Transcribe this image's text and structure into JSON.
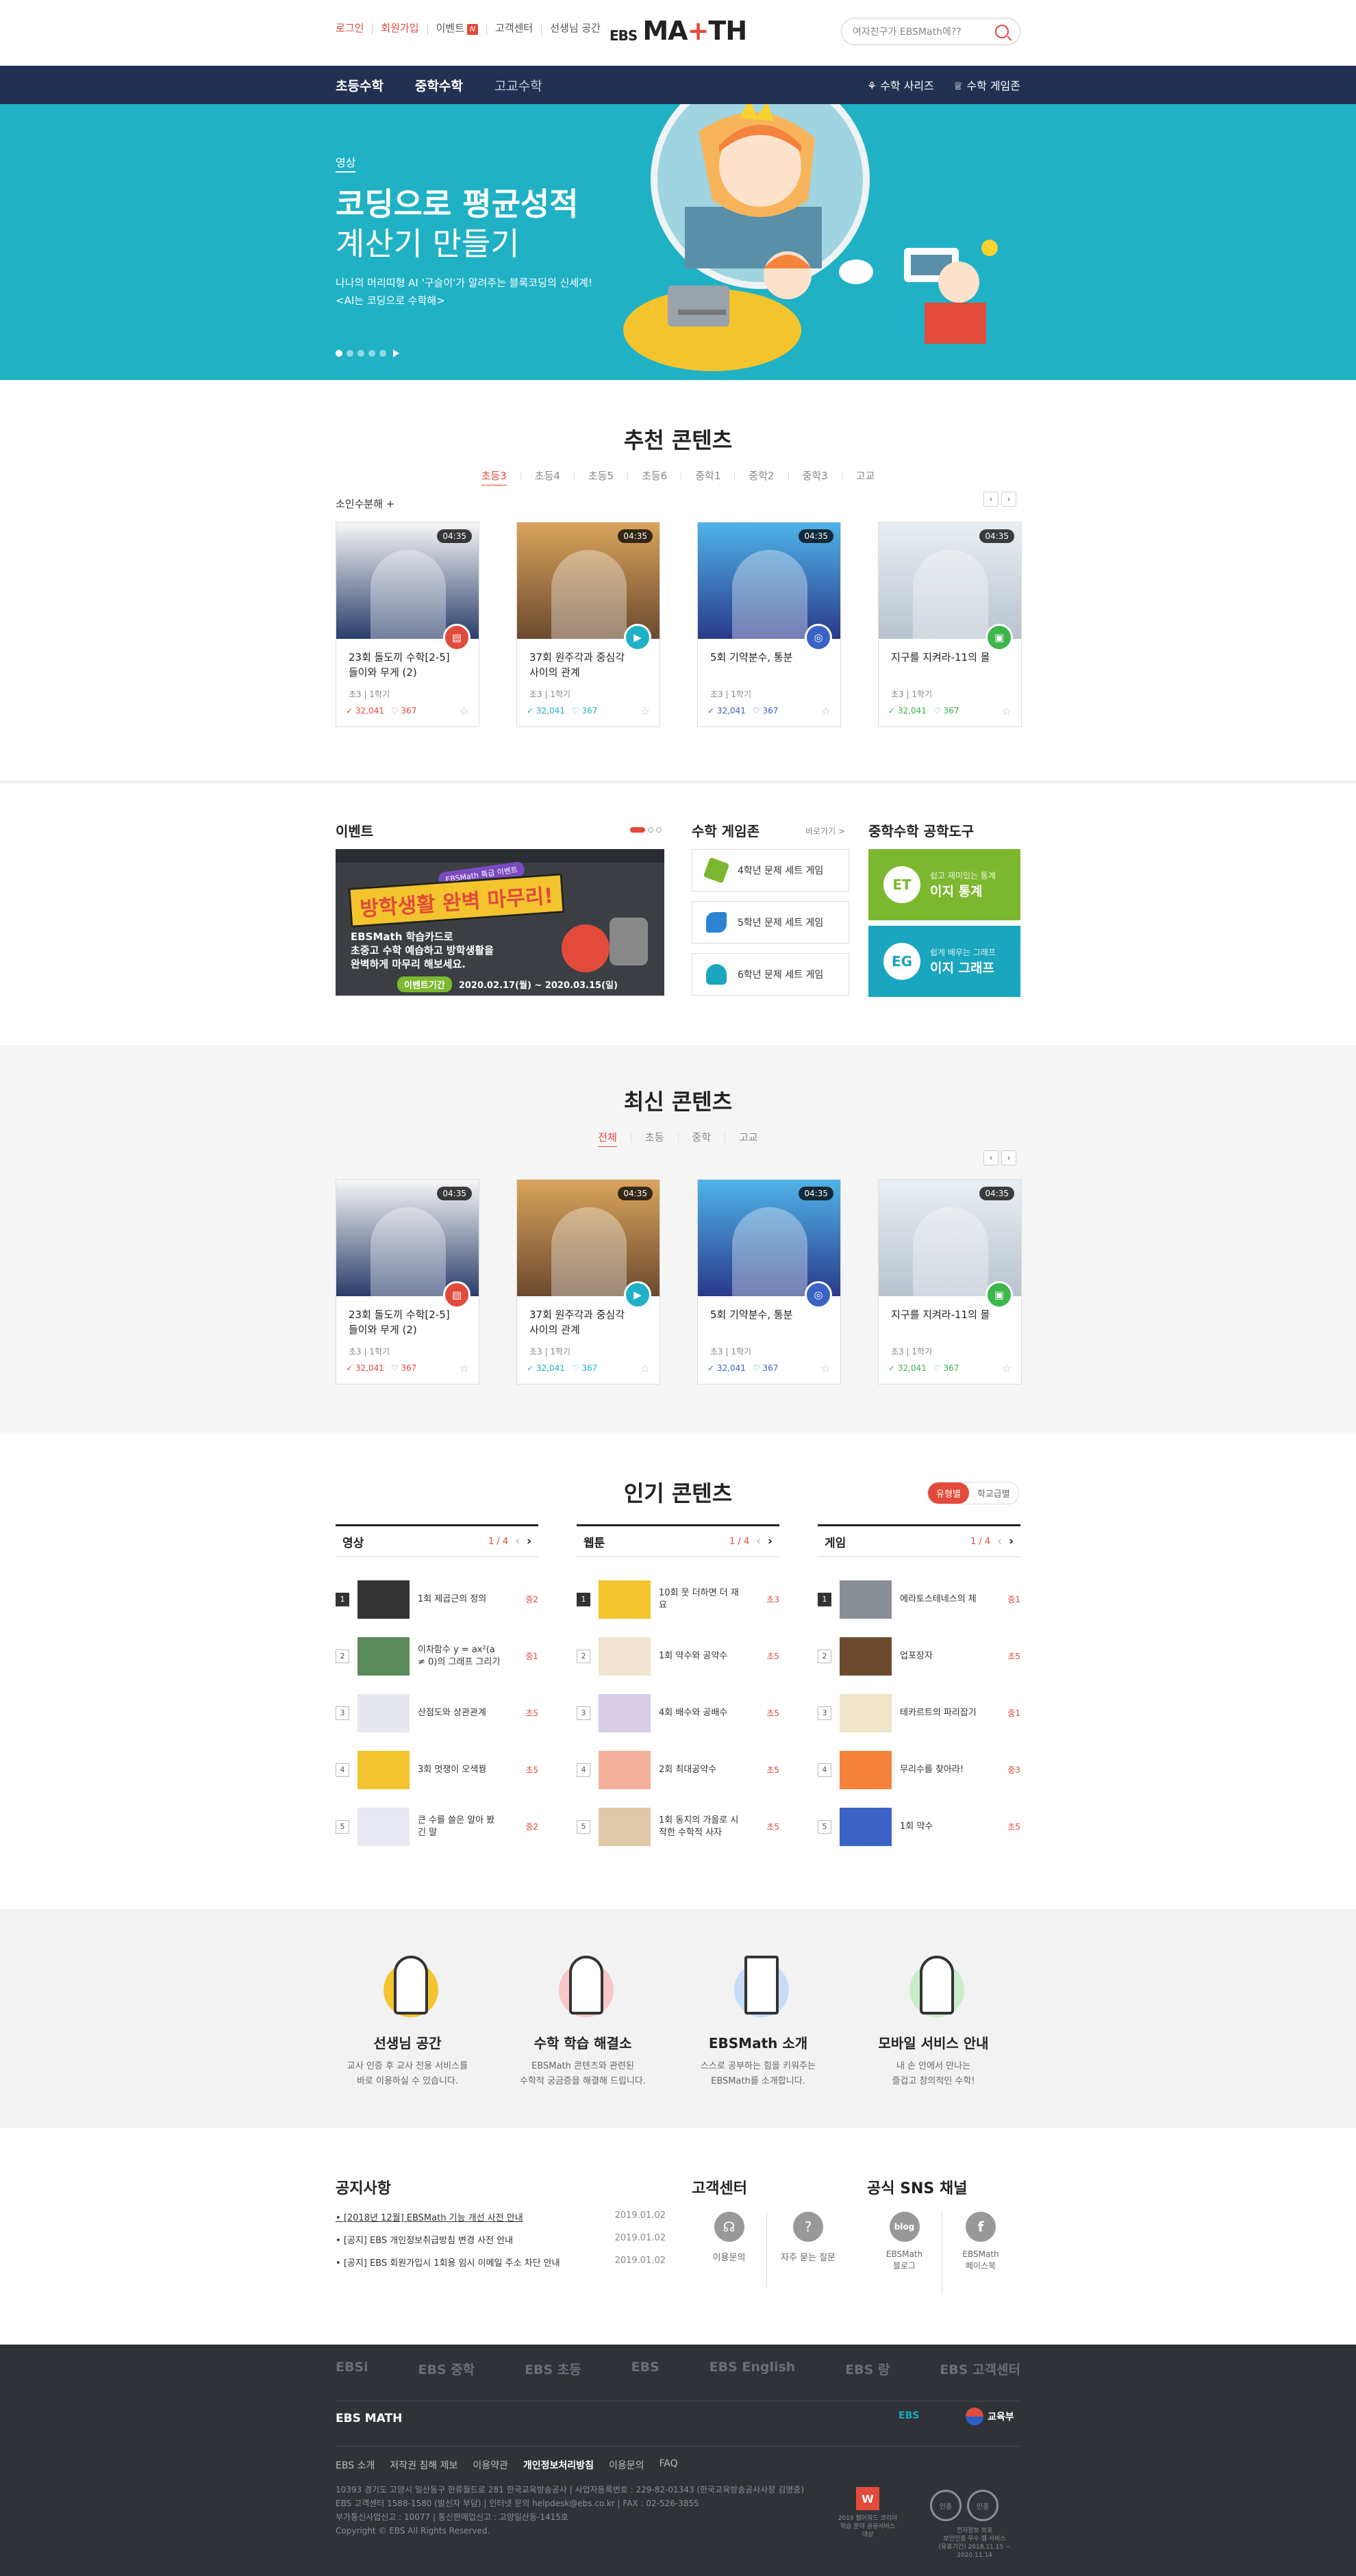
{
  "util": [
    "로그인",
    "회원가입",
    "이벤트",
    "고객센터",
    "선생님 공간"
  ],
  "util_badge": "N",
  "logo": {
    "ebs": "EBS",
    "m": "M",
    "a": "A",
    "plus": "+",
    "th": "TH"
  },
  "search_placeholder": "여자친구가 EBSMath에??",
  "gnb": {
    "items": [
      "초등수학",
      "중학수학",
      "고교수학"
    ],
    "right": [
      "수학 사리즈",
      "수학 게임존"
    ]
  },
  "hero": {
    "tag": "영상",
    "title1": "코딩으로 평균성적",
    "title2": "계산기 만들기",
    "desc1": "나나의 머리띠형 AI '구슬이'가 알려주는 블록코딩의 신세계!",
    "desc2": "<AI는 코딩으로 수학해>"
  },
  "recommend": {
    "title": "추천 콘텐츠",
    "tabs": [
      "초등3",
      "초등4",
      "초등5",
      "초등6",
      "중학1",
      "중학2",
      "중학3",
      "고교"
    ],
    "sub": "소인수분해 +"
  },
  "cards": [
    {
      "title": "23회 돌도끼 수학[2-5] 들이와 무게 (2)",
      "meta": "초3  |  1학기",
      "views": "32,041",
      "likes": "367",
      "dur": "04:35",
      "kind_color": "#e24a3b"
    },
    {
      "title": "37회 원주각과 중심각 사이의 관계",
      "meta": "초3  |  1학기",
      "views": "32,041",
      "likes": "367",
      "dur": "04:35",
      "kind_color": "#20b1c5"
    },
    {
      "title": "5회 기약분수, 통분",
      "meta": "초3  |  1학기",
      "views": "32,041",
      "likes": "367",
      "dur": "04:35",
      "kind_color": "#3a63c5"
    },
    {
      "title": "지구를 지켜라-11의 몰",
      "meta": "초3  |  1학기",
      "views": "32,041",
      "likes": "367",
      "dur": "04:35",
      "kind_color": "#3cb54a"
    }
  ],
  "cards2": [
    {
      "title": "23회 돌도끼 수학[2-5] 들이와 무게 (2)",
      "meta": "초3  |  1학기",
      "views": "32,041",
      "likes": "367",
      "dur": "04:35"
    },
    {
      "title": "37회 원주각과 중심각 사이의 관계",
      "meta": "초3  |  1학기",
      "views": "32,041",
      "likes": "367",
      "dur": "04:35"
    },
    {
      "title": "5회 기약분수, 통분",
      "meta": "초3  |  1학기",
      "views": "32,041",
      "likes": "367",
      "dur": "04:35"
    },
    {
      "title": "지구를 지켜라-11의 몰",
      "meta": "초3  |  1학기",
      "views": "32,041",
      "likes": "367",
      "dur": "04:35"
    }
  ],
  "event": {
    "title": "이벤트",
    "banner1": "방학생활 완벽 마무리!",
    "banner_tag": "EBSMath 특급 이벤트",
    "banner2": "EBSMath 학습카드로",
    "banner3": "초중고 수학 예습하고 방학생활을",
    "banner4": "완벽하게 마무리 해보세요.",
    "period_label": "이벤트기간",
    "period": "2020.02.17(월) ~ 2020.03.15(일)"
  },
  "gamezone": {
    "title": "수학 게임존",
    "more": "바로가기 >",
    "items": [
      "4학년 문제 세트 게임",
      "5학년 문제 세트 게임",
      "6학년 문제 세트 게임"
    ]
  },
  "tools": {
    "title": "중학수학 공학도구",
    "items": [
      {
        "sub": "쉽고 재미있는 통계",
        "name": "이지 통계",
        "abbr": "ET",
        "color": "#7cb82f"
      },
      {
        "sub": "쉽게 배우는 그래프",
        "name": "이지 그래프",
        "abbr": "EG",
        "color": "#1aa6be"
      }
    ]
  },
  "latest": {
    "title": "최신 콘텐츠",
    "tabs": [
      "전체",
      "초등",
      "중학",
      "고교"
    ]
  },
  "popular": {
    "title": "인기 콘텐츠",
    "toggle": [
      "유형별",
      "학교급별"
    ],
    "cols": [
      {
        "name": "영상",
        "page": "1 / 4",
        "items": [
          {
            "t": "1회 제곱근의 정의",
            "g": "중2"
          },
          {
            "t": "이차함수 y = ax²(a ≠ 0)의 그래프 그리기",
            "g": "중1"
          },
          {
            "t": "산점도와 상관관계",
            "g": "초5"
          },
          {
            "t": "3회 멋쟁이 오색꿩",
            "g": "초5"
          },
          {
            "t": "큰 수를 쓸은 알아 봤긴 말",
            "g": "중2"
          }
        ]
      },
      {
        "name": "웹툰",
        "page": "1 / 4",
        "items": [
          {
            "t": "10회 뭇 더하면 더 재요",
            "g": "초3"
          },
          {
            "t": "1회 약수와 공약수",
            "g": "초5"
          },
          {
            "t": "4회 배수와 공배수",
            "g": "초5"
          },
          {
            "t": "2회 최대공약수",
            "g": "초5"
          },
          {
            "t": "1회 동지의 가을로 시작한 수학적 사자",
            "g": "초5"
          }
        ]
      },
      {
        "name": "게임",
        "page": "1 / 4",
        "items": [
          {
            "t": "에라토스테네스의 체",
            "g": "중1"
          },
          {
            "t": "업포장자",
            "g": "초5"
          },
          {
            "t": "테카르트의 파리잡기",
            "g": "중1"
          },
          {
            "t": "무리수를 찾아라!",
            "g": "중3"
          },
          {
            "t": "1회 약수",
            "g": "초5"
          }
        ]
      }
    ]
  },
  "services": [
    {
      "title": "선생님 공간",
      "d1": "교사 인증 후 교사 전용 서비스를",
      "d2": "바로 이용하실 수 있습니다."
    },
    {
      "title": "수학 학습 해결소",
      "d1": "EBSMath 콘텐츠와 관련된",
      "d2": "수학적 궁금증을 해결해 드립니다."
    },
    {
      "title": "EBSMath 소개",
      "d1": "스스로 공부하는 힘을 키워주는",
      "d2": "EBSMath를 소개합니다."
    },
    {
      "title": "모바일 서비스 안내",
      "d1": "내 손 안에서 만나는",
      "d2": "즐겁고 창의적인 수학!"
    }
  ],
  "notice": {
    "title": "공지사항",
    "items": [
      {
        "t": "[2018년 12월] EBSMath 기능 개선 사전 안내",
        "d": "2019.01.02"
      },
      {
        "t": "[공지] EBS 개인정보취급방침 변경 사전 안내",
        "d": "2019.01.02"
      },
      {
        "t": "[공지] EBS 회원가입시 1회용 임시 이메일 주소 차단 안내",
        "d": "2019.01.02"
      }
    ]
  },
  "cs": {
    "title": "고객센터",
    "items": [
      "이용문의",
      "자주 묻는 질문"
    ]
  },
  "sns": {
    "title": "공식 SNS 채널",
    "items": [
      {
        "l1": "EBSMath",
        "l2": "블로그",
        "ic": "blog"
      },
      {
        "l1": "EBSMath",
        "l2": "페이스북",
        "ic": "f"
      }
    ]
  },
  "family": [
    "EBSi",
    "EBS 중학",
    "EBS 초등",
    "EBS",
    "EBS English",
    "EBS 랑",
    "EBS 고객센터"
  ],
  "footer_logo": "EBS MATH",
  "footer_right": [
    "EBS",
    "교육부"
  ],
  "footer_nav": [
    "EBS 소개",
    "저작권 침해 제보",
    "이용약관",
    "개인정보처리방침",
    "이용문의",
    "FAQ"
  ],
  "footer_addr": [
    "10393 경기도 고양시 일산동구 한류월드로 281 한국교육방송공사 | 사업자등록번호 : 229-82-01343 (한국교육방송공사사장 김명중)",
    "EBS 고객센터 1588-1580 (발신자 부담) | 인터넷 문의 helpdesk@ebs.co.kr | FAX : 02-526-3855",
    "부가통신사업신고 : 10077 | 통신판매업신고 : 고양일산동-1415호",
    "Copyright © EBS All Rights Reserved."
  ],
  "award": [
    "2019 웹어워드 코리아",
    "학습 분야 공공서비스 대상"
  ],
  "certs": [
    "인증",
    "인증"
  ],
  "cert_note": [
    "전자정보 보호",
    "보안인증 우수 웹 서비스",
    "(유효기간) 2018.11.15 ~ 2020.11.14"
  ]
}
